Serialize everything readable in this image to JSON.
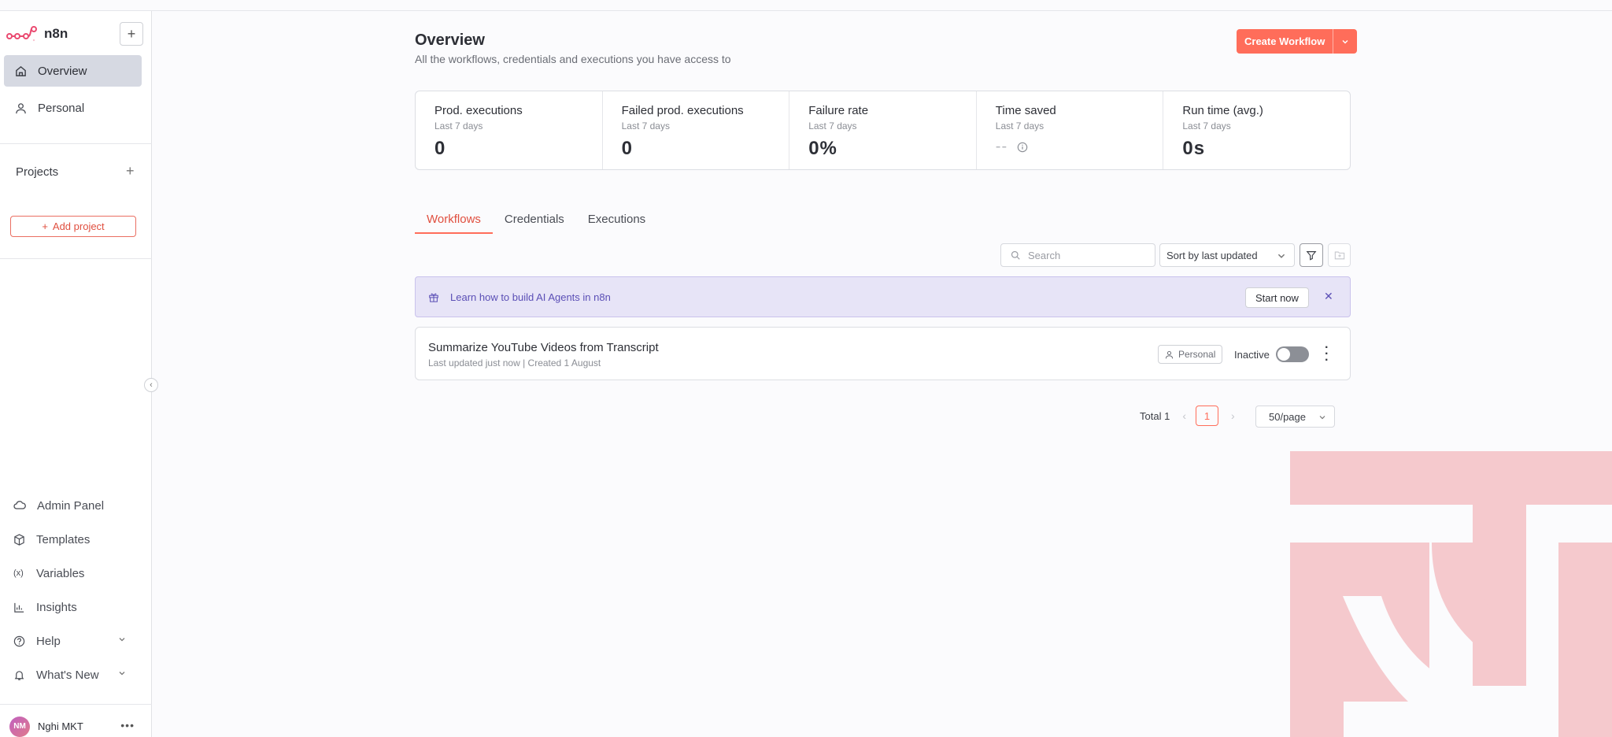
{
  "app": {
    "name": "n8n"
  },
  "sidebar": {
    "nav": [
      {
        "label": "Overview",
        "icon": "home-icon",
        "active": true
      },
      {
        "label": "Personal",
        "icon": "user-icon",
        "active": false
      }
    ],
    "projects_title": "Projects",
    "add_project_label": "Add project",
    "bottom": [
      {
        "label": "Admin Panel",
        "icon": "cloud-icon"
      },
      {
        "label": "Templates",
        "icon": "box-icon"
      },
      {
        "label": "Variables",
        "icon": "variable-icon"
      },
      {
        "label": "Insights",
        "icon": "chart-icon"
      },
      {
        "label": "Help",
        "icon": "help-icon",
        "expandable": true
      },
      {
        "label": "What's New",
        "icon": "bell-icon",
        "expandable": true
      }
    ],
    "user": {
      "initials": "NM",
      "name": "Nghi MKT"
    }
  },
  "header": {
    "title": "Overview",
    "subtitle": "All the workflows, credentials and executions you have access to",
    "create_label": "Create Workflow"
  },
  "stats": [
    {
      "label": "Prod. executions",
      "period": "Last 7 days",
      "value": "0"
    },
    {
      "label": "Failed prod. executions",
      "period": "Last 7 days",
      "value": "0"
    },
    {
      "label": "Failure rate",
      "period": "Last 7 days",
      "value": "0%"
    },
    {
      "label": "Time saved",
      "period": "Last 7 days",
      "value": "--"
    },
    {
      "label": "Run time (avg.)",
      "period": "Last 7 days",
      "value": "0s"
    }
  ],
  "tabs": [
    {
      "label": "Workflows",
      "active": true
    },
    {
      "label": "Credentials",
      "active": false
    },
    {
      "label": "Executions",
      "active": false
    }
  ],
  "toolbar": {
    "search_placeholder": "Search",
    "sort_value": "Sort by last updated"
  },
  "banner": {
    "text": "Learn how to build AI Agents in n8n",
    "button_label": "Start now"
  },
  "workflows": [
    {
      "title": "Summarize YouTube Videos from Transcript",
      "meta": "Last updated just now | Created 1 August",
      "owner": "Personal",
      "status": "Inactive",
      "active": false
    }
  ],
  "pagination": {
    "total_label": "Total 1",
    "current_page": "1",
    "page_size": "50/page"
  },
  "colors": {
    "accent": "#ff6d5a",
    "banner_bg": "#e7e4f7",
    "banner_text": "#5b4fb6",
    "watermark": "#f5c9cd"
  }
}
